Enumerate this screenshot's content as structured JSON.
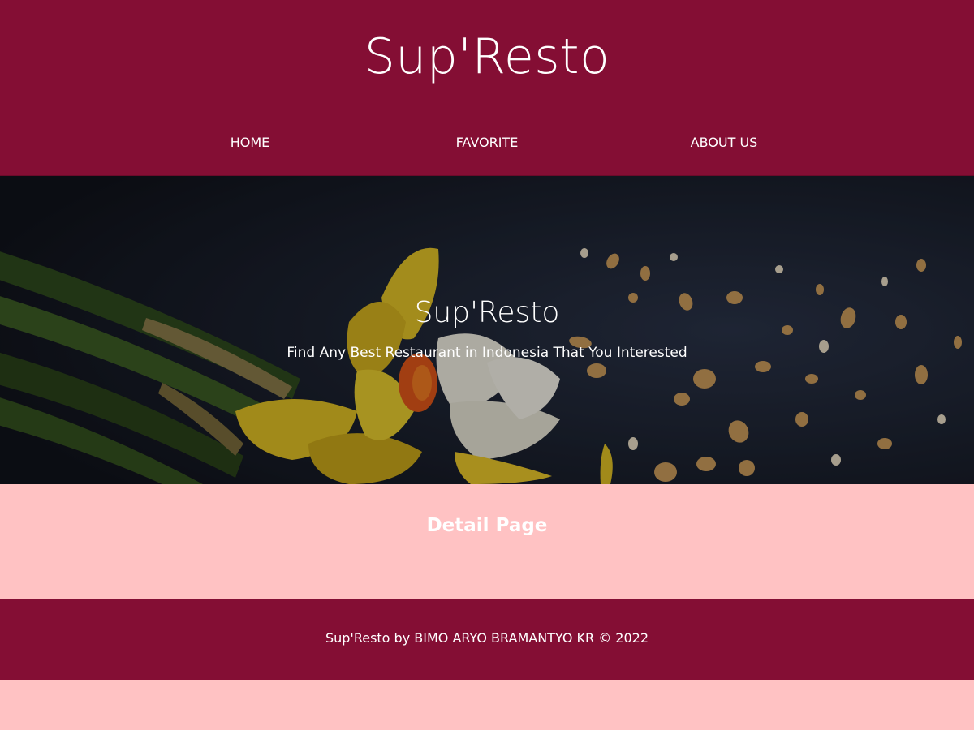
{
  "header": {
    "title": "Sup'Resto",
    "nav": {
      "home": "HOME",
      "favorite": "FAVORITE",
      "about": "ABOUT US"
    }
  },
  "hero": {
    "title": "Sup'Resto",
    "tagline": "Find Any Best Restaurant in Indonesia That You Interested"
  },
  "main": {
    "heading": "Detail Page"
  },
  "footer": {
    "text": "Sup'Resto by BIMO ARYO BRAMANTYO KR © 2022"
  },
  "colors": {
    "header_bg": "#840e34",
    "page_bg": "#ffc2c3",
    "text": "#ffffff"
  }
}
